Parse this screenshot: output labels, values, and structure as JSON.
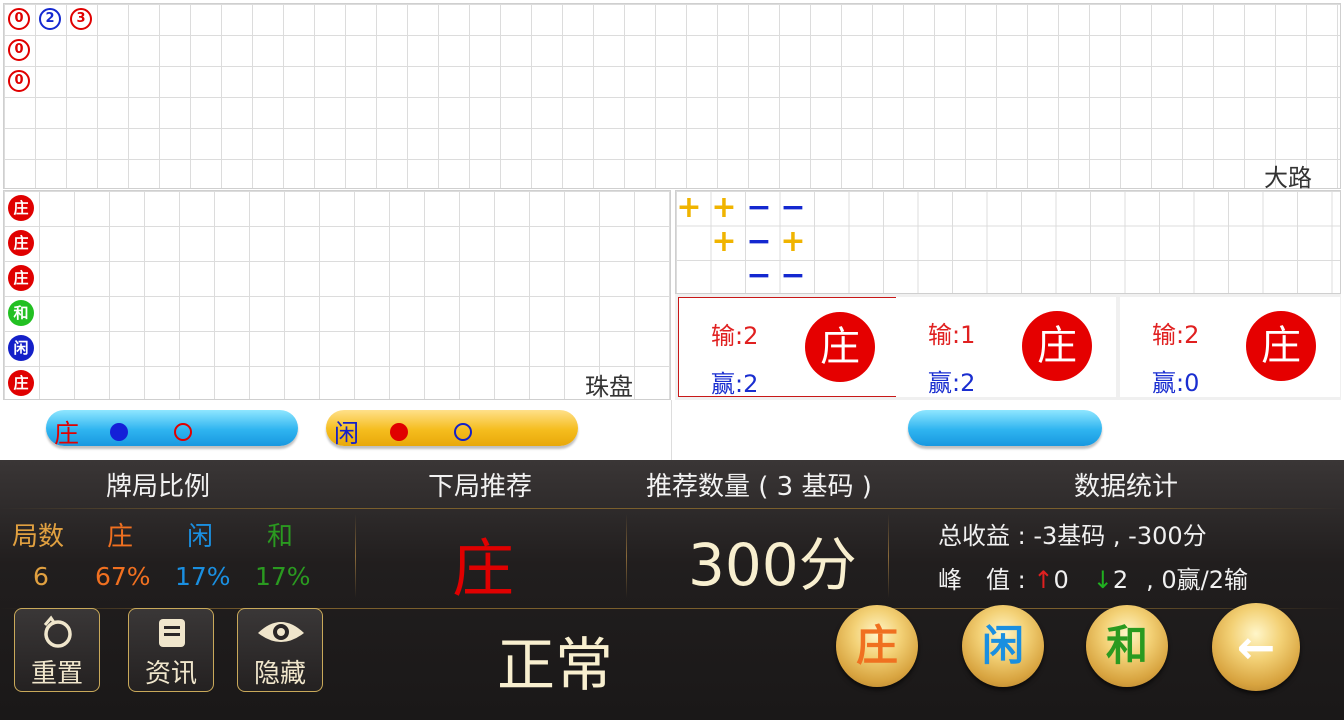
{
  "big_road": {
    "label": "大路",
    "counts": [
      "0",
      "2",
      "3"
    ],
    "column_counts": [
      "0",
      "0"
    ]
  },
  "bead_plate": {
    "label": "珠盘",
    "beads": [
      {
        "text": "庄",
        "color": "#e00000"
      },
      {
        "text": "庄",
        "color": "#e00000"
      },
      {
        "text": "庄",
        "color": "#e00000"
      },
      {
        "text": "和",
        "color": "#22c022"
      },
      {
        "text": "闲",
        "color": "#1420c8"
      },
      {
        "text": "庄",
        "color": "#e00000"
      }
    ]
  },
  "derived_road": {
    "row1": [
      "+",
      "+",
      "−",
      "−"
    ],
    "row2": [
      "+",
      "−",
      "+"
    ],
    "row3": [
      "−",
      "−"
    ],
    "plus_color": "#f0b400",
    "minus_color": "#1428d0"
  },
  "predict": {
    "banker_label": "庄",
    "player_label": "闲"
  },
  "cards": [
    {
      "lose": "输:2",
      "win": "赢:2",
      "side": "庄"
    },
    {
      "lose": "输:1",
      "win": "赢:2",
      "side": "庄"
    },
    {
      "lose": "输:2",
      "win": "赢:0",
      "side": "庄"
    }
  ],
  "panel": {
    "h_ratio": "牌局比例",
    "h_next": "下局推荐",
    "h_qty": "推荐数量 ( 3 基码 )",
    "h_stats": "数据统计",
    "ratio_headers": [
      "局数",
      "庄",
      "闲",
      "和"
    ],
    "ratio_values": [
      "6",
      "67%",
      "17%",
      "17%"
    ],
    "next": "庄",
    "qty": "300分",
    "total": "总收益 : -3基码 , -300分",
    "peak_label": "峰　值 : ",
    "peak_up": "0",
    "peak_down": "2",
    "peak_rest": ", 0赢/2输",
    "status": "正常",
    "btn_reset": "重置",
    "btn_info": "资讯",
    "btn_hide": "隐藏",
    "round_banker": "庄",
    "round_player": "闲",
    "round_tie": "和",
    "round_back": "←"
  },
  "colors": {
    "banker": "#e00000",
    "player": "#1a8fe0",
    "tie": "#2a9a20",
    "orange": "#f07020",
    "gold": "#c9a95a"
  }
}
